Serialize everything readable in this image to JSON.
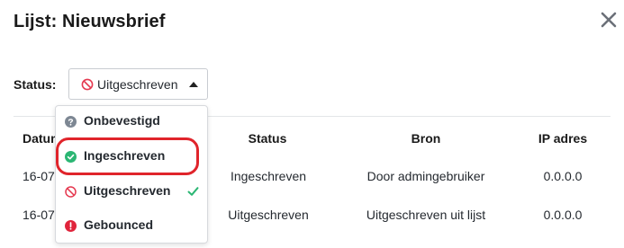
{
  "dialog": {
    "title": "Lijst: Nieuwsbrief"
  },
  "filter": {
    "label": "Status:",
    "selected": "Uitgeschreven",
    "options": [
      {
        "label": "Onbevestigd",
        "icon": "question-circle-icon",
        "color": "#7d8793"
      },
      {
        "label": "Ingeschreven",
        "icon": "check-circle-icon",
        "color": "#2bb673"
      },
      {
        "label": "Uitgeschreven",
        "icon": "ban-icon",
        "color": "#e53950",
        "selected": true
      },
      {
        "label": "Gebounced",
        "icon": "exclamation-circle-icon",
        "color": "#e0243b"
      }
    ]
  },
  "table": {
    "headers": [
      "Datum",
      "Status",
      "Bron",
      "IP adres"
    ],
    "rows": [
      {
        "date": "16-07",
        "status": "Ingeschreven",
        "source": "Door admingebruiker",
        "ip": "0.0.0.0"
      },
      {
        "date": "16-07",
        "status": "Uitgeschreven",
        "source": "Uitgeschreven uit lijst",
        "ip": "0.0.0.0"
      }
    ]
  },
  "colors": {
    "highlight": "#e0242b",
    "check": "#2bb673"
  }
}
